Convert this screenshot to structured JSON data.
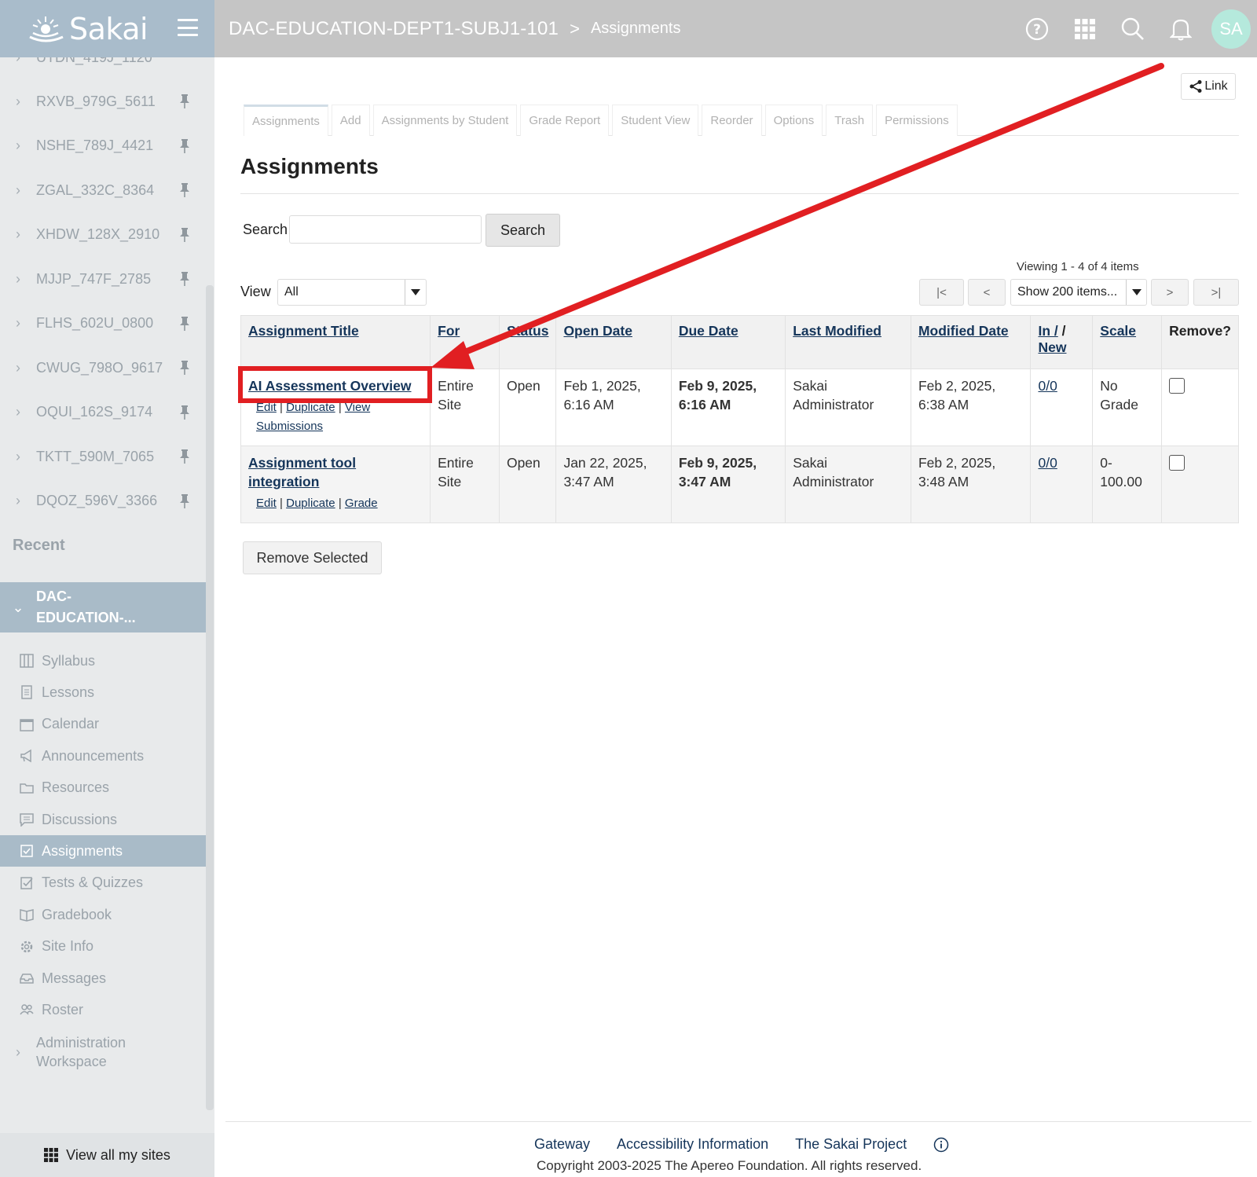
{
  "header": {
    "logo_text": "Sakai",
    "site_title": "DAC-EDUCATION-DEPT1-SUBJ1-101",
    "separator": ">",
    "tool_title": "Assignments",
    "avatar_initials": "SA"
  },
  "sidebar": {
    "partial_top_site": "UTDN_419J_1120",
    "sites": [
      "RXVB_979G_5611",
      "NSHE_789J_4421",
      "ZGAL_332C_8364",
      "XHDW_128X_2910",
      "MJJP_747F_2785",
      "FLHS_602U_0800",
      "CWUG_798O_9617",
      "OQUI_162S_9174",
      "TKTT_590M_7065",
      "DQOZ_596V_3366"
    ],
    "recent_heading": "Recent",
    "current_site": "DAC-EDUCATION-...",
    "tools": [
      {
        "label": "Syllabus",
        "icon": "syllabus-icon"
      },
      {
        "label": "Lessons",
        "icon": "lessons-icon"
      },
      {
        "label": "Calendar",
        "icon": "calendar-icon"
      },
      {
        "label": "Announcements",
        "icon": "megaphone-icon"
      },
      {
        "label": "Resources",
        "icon": "folder-icon"
      },
      {
        "label": "Discussions",
        "icon": "discussion-icon"
      },
      {
        "label": "Assignments",
        "icon": "assignment-icon"
      },
      {
        "label": "Tests & Quizzes",
        "icon": "quiz-icon"
      },
      {
        "label": "Gradebook",
        "icon": "gradebook-icon"
      },
      {
        "label": "Site Info",
        "icon": "gear-icon"
      },
      {
        "label": "Messages",
        "icon": "inbox-icon"
      },
      {
        "label": "Roster",
        "icon": "people-icon"
      }
    ],
    "active_tool": "Assignments",
    "admin_workspace": "Administration Workspace",
    "view_all_sites": "View all my sites"
  },
  "main": {
    "link_button": "Link",
    "tabs": [
      "Assignments",
      "Add",
      "Assignments by Student",
      "Grade Report",
      "Student View",
      "Reorder",
      "Options",
      "Trash",
      "Permissions"
    ],
    "active_tab": "Assignments",
    "page_title": "Assignments",
    "search": {
      "label": "Search",
      "value": "",
      "button": "Search"
    },
    "viewing": "Viewing 1 - 4 of 4 items",
    "view": {
      "label": "View",
      "selected": "All"
    },
    "pager": {
      "first": "|<",
      "prev": "<",
      "page_size": "Show 200 items...",
      "next": ">",
      "last": ">|"
    },
    "table": {
      "columns": [
        "Assignment Title",
        "For",
        "Status",
        "Open Date",
        "Due Date",
        "Last Modified",
        "Modified Date",
        "In /",
        "New",
        "Scale",
        "Remove?"
      ],
      "rows": [
        {
          "title": "AI Assessment Overview",
          "actions": [
            "Edit",
            "Duplicate",
            "View Submissions"
          ],
          "for": "Entire Site",
          "status": "Open",
          "open_date": "Feb 1, 2025, 6:16 AM",
          "due_date": "Feb 9, 2025, 6:16 AM",
          "last_modified": "Sakai Administrator",
          "modified_date": "Feb 2, 2025, 6:38 AM",
          "in_new": "0/0",
          "scale": "No Grade"
        },
        {
          "title": "Assignment tool integration",
          "actions": [
            "Edit",
            "Duplicate",
            "Grade"
          ],
          "for": "Entire Site",
          "status": "Open",
          "open_date": "Jan 22, 2025, 3:47 AM",
          "due_date": "Feb 9, 2025, 3:47 AM",
          "last_modified": "Sakai Administrator",
          "modified_date": "Feb 2, 2025, 3:48 AM",
          "in_new": "0/0",
          "scale": "0-100.00"
        }
      ]
    },
    "remove_button": "Remove Selected"
  },
  "footer": {
    "links": [
      "Gateway",
      "Accessibility Information",
      "The Sakai Project"
    ],
    "copyright": "Copyright 2003-2025 The Apereo Foundation. All rights reserved."
  },
  "colors": {
    "header_bar": "#c5c5c5",
    "logo_panel": "#a9bccb",
    "avatar": "#b5e9dc",
    "active_tool": "#a9bbc8",
    "link": "#15355a",
    "due_date": "#9b1c1c",
    "annotation_red": "#e11f22"
  }
}
